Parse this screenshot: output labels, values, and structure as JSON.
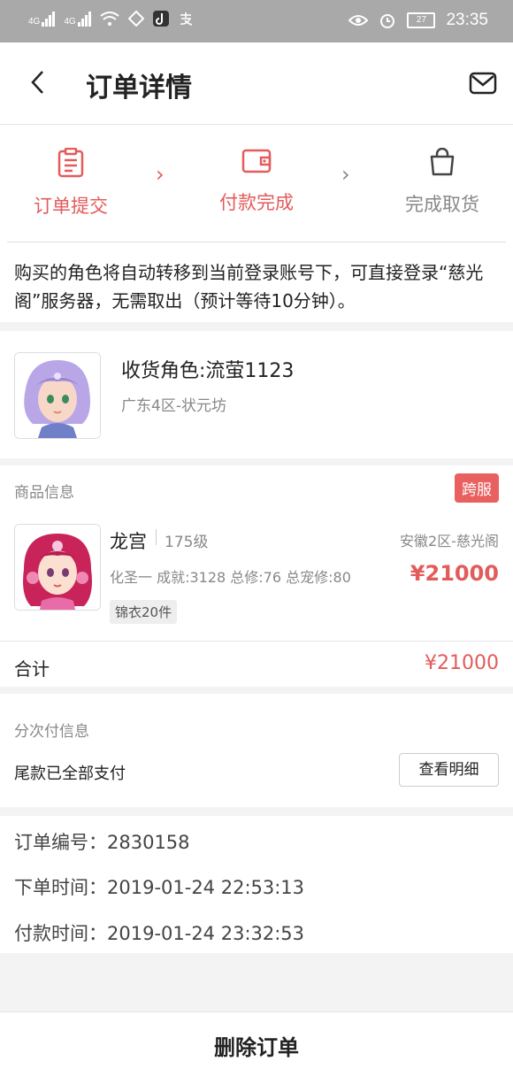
{
  "status_bar": {
    "network1": "4G",
    "network2": "4G",
    "battery": "27",
    "time": "23:35"
  },
  "header": {
    "title": "订单详情"
  },
  "steps": [
    {
      "label": "订单提交",
      "state": "done"
    },
    {
      "label": "付款完成",
      "state": "done"
    },
    {
      "label": "完成取货",
      "state": "pending"
    }
  ],
  "colors": {
    "accent": "#e35b5b",
    "muted": "#888888"
  },
  "notice": {
    "text": "购买的角色将自动转移到当前登录账号下，可直接登录“慈光阁”服务器，无需取出（预计等待10分钟）。"
  },
  "receiver": {
    "title": "收货角色:流萤1123",
    "server": "广东4区-状元坊"
  },
  "goods": {
    "section_label": "商品信息",
    "cross_server_tag": "跨服",
    "name": "龙宫",
    "level": "175级",
    "server": "安徽2区-慈光阁",
    "stats": "化圣一 成就:3128 总修:76 总宠修:80",
    "price": "¥21000",
    "chip": "锦衣20件",
    "total_label": "合计",
    "total_value": "¥21000"
  },
  "installment": {
    "section_label": "分次付信息",
    "status": "尾款已全部支付",
    "detail_button": "查看明细"
  },
  "order_info": {
    "number": "订单编号：2830158",
    "order_time": "下单时间：2019-01-24 22:53:13",
    "pay_time": "付款时间：2019-01-24 23:32:53"
  },
  "bottom": {
    "delete_button": "删除订单"
  }
}
